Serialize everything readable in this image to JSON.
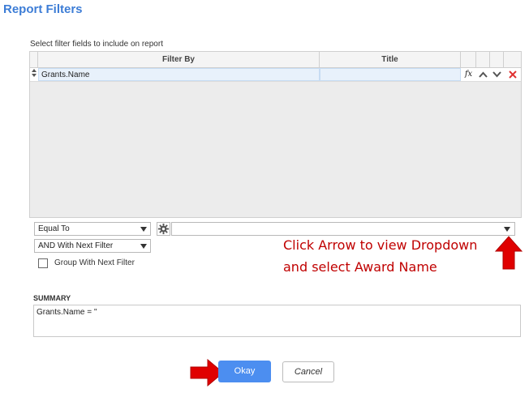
{
  "header": {
    "title": "Report Filters"
  },
  "filters": {
    "instruction": "Select filter fields to include on report",
    "columns": {
      "filter_by": "Filter By",
      "title": "Title"
    },
    "rows": [
      {
        "filter_by": "Grants.Name",
        "title": ""
      }
    ]
  },
  "condition": {
    "operator": "Equal To",
    "value": "",
    "joiner": "AND With Next Filter",
    "group_label": "Group With Next Filter",
    "group_checked": false
  },
  "annotation": {
    "line1": "Click Arrow to view Dropdown",
    "line2": "and select Award Name",
    "color": "#c00000"
  },
  "summary": {
    "label": "SUMMARY",
    "text": "Grants.Name = ''"
  },
  "buttons": {
    "okay": "Okay",
    "cancel": "Cancel"
  },
  "colors": {
    "accent": "#4c8ef0",
    "title": "#3d7dd6",
    "arrow": "#e00000"
  }
}
